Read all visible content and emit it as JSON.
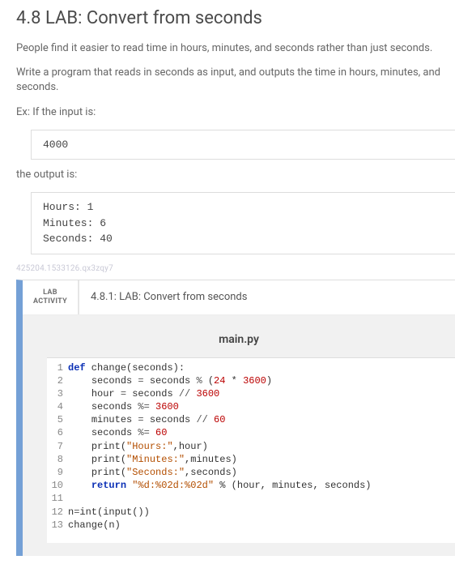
{
  "title": "4.8 LAB: Convert from seconds",
  "para1": "People find it easier to read time in hours, minutes, and seconds rather than just seconds.",
  "para2": "Write a program that reads in seconds as input, and outputs the time in hours, minutes, and seconds.",
  "para3": "Ex: If the input is:",
  "input_box": "4000",
  "para4": "the output is:",
  "output_lines": [
    "Hours: 1",
    "Minutes: 6",
    "Seconds: 40"
  ],
  "tiny_id": "425204.1533126.qx3zqy7",
  "activity": {
    "badge_line1": "LAB",
    "badge_line2": "ACTIVITY",
    "title": "4.8.1: LAB: Convert from seconds",
    "filename": "main.py"
  },
  "code": {
    "l1": {
      "kw": "def",
      "fn": " change",
      "rest": "(seconds):"
    },
    "l2": {
      "indent": "    ",
      "a": "seconds ",
      "op": "=",
      "b": " seconds ",
      "op2": "%",
      "c": " (",
      "n1": "24",
      "d": " * ",
      "n2": "3600",
      "e": ")"
    },
    "l3": {
      "indent": "    ",
      "a": "hour ",
      "op": "=",
      "b": " seconds ",
      "op2": "//",
      "c": " ",
      "n1": "3600"
    },
    "l4": {
      "indent": "    ",
      "a": "seconds ",
      "op": "%=",
      "b": " ",
      "n1": "3600"
    },
    "l5": {
      "indent": "    ",
      "a": "minutes ",
      "op": "=",
      "b": " seconds ",
      "op2": "//",
      "c": " ",
      "n1": "60"
    },
    "l6": {
      "indent": "    ",
      "a": "seconds ",
      "op": "%=",
      "b": " ",
      "n1": "60"
    },
    "l7": {
      "indent": "    ",
      "fn": "print",
      "p": "(",
      "s": "\"Hours:\"",
      "rest": ",hour)"
    },
    "l8": {
      "indent": "    ",
      "fn": "print",
      "p": "(",
      "s": "\"Minutes:\"",
      "rest": ",minutes)"
    },
    "l9": {
      "indent": "    ",
      "fn": "print",
      "p": "(",
      "s": "\"Seconds:\"",
      "rest": ",seconds)"
    },
    "l10": {
      "indent": "    ",
      "kw": "return",
      "sp": " ",
      "s": "\"%d:%02d:%02d\"",
      "rest": " % (hour, minutes, seconds)"
    },
    "l11": {
      "text": ""
    },
    "l12": {
      "a": "n",
      "op": "=",
      "fn": "int",
      "p": "(",
      "fn2": "input",
      "rest": "())"
    },
    "l13": {
      "fn": "change",
      "rest": "(n)"
    }
  }
}
